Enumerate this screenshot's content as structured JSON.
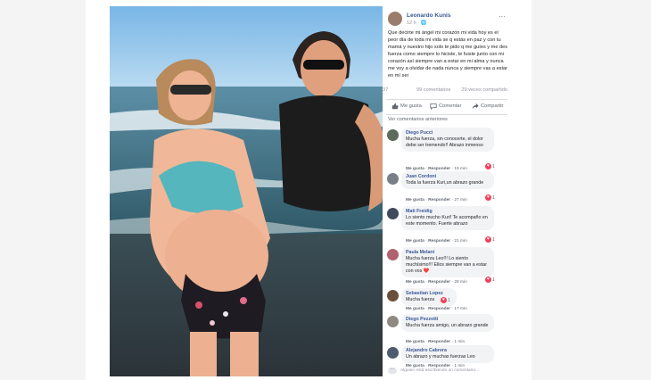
{
  "post": {
    "author": "Leonardo Kunis",
    "time": "12 h",
    "text": "Que decirte mi ángel mi corazón mi vida hoy es el peor día de toda mi vida se q estás en paz y con tu mamá y nuestro hijo solo te pido q me guíes y me des fuerza como siempre lo hiciste, te fuiste junto con mi corazón así siempre van a estar en mi alma y nunca me voy a olvidar de nada nunca y siempre vas a estar en mí ser",
    "like_count": "37",
    "comments_count": "99 comentarios",
    "shares_count": "29 veces compartido"
  },
  "actions": {
    "like": "Me gusta",
    "comment": "Comentar",
    "share": "Compartir"
  },
  "view_previous": "Ver comentarios anteriores",
  "comments": [
    {
      "name": "Diego Pucci",
      "text": "Mucha fuerza, sin conocerte, el dolor debe ser tremendo!! Abrazo inmenso",
      "like": "Me gusta",
      "reply": "Responder",
      "time": "19 min",
      "reactions": "1",
      "avatar_color": "#5c6b5a"
    },
    {
      "name": "Juan Cordoni",
      "text": "Toda la fuerza Kuri,un abrazo grande",
      "like": "Me gusta",
      "reply": "Responder",
      "time": "27 min",
      "reactions": "1",
      "avatar_color": "#7a7f87"
    },
    {
      "name": "Mati Freidig",
      "text": "Lo siento mucho Kuri! Te acompaño en este momento. Fuerte abrazo",
      "like": "Me gusta",
      "reply": "Responder",
      "time": "21 min",
      "reactions": "1",
      "avatar_color": "#3f4a5c"
    },
    {
      "name": "Paula Melani",
      "text": "Mucha fuerza Leo!!! Lo siento muchísimo!!! Ellos siempre van a estar con vos ❤️",
      "like": "Me gusta",
      "reply": "Responder",
      "time": "28 min",
      "reactions": "1",
      "avatar_color": "#b0626e"
    },
    {
      "name": "Sebastian Lopez",
      "text": "Mucha fuerza",
      "like": "Me gusta",
      "reply": "Responder",
      "time": "17 min",
      "reactions": "1",
      "avatar_color": "#6b4f3a"
    },
    {
      "name": "Diego Pezzotti",
      "text": "Mucha fuerza amigo, un abrazo grande",
      "like": "Me gusta",
      "reply": "Responder",
      "time": "1 min",
      "reactions": "",
      "avatar_color": "#8e8a80"
    },
    {
      "name": "Alejandro Cabrera",
      "text": "Un abrazo y muchas fuerzas Leo",
      "like": "Me gusta",
      "reply": "Responder",
      "time": "1 min",
      "reactions": "",
      "avatar_color": "#4d5b6e"
    }
  ],
  "typing": "Alguien está escribiendo un comentario...",
  "colors": {
    "link": "#385898",
    "bubble": "#f2f3f5",
    "heart": "#f33e58"
  }
}
